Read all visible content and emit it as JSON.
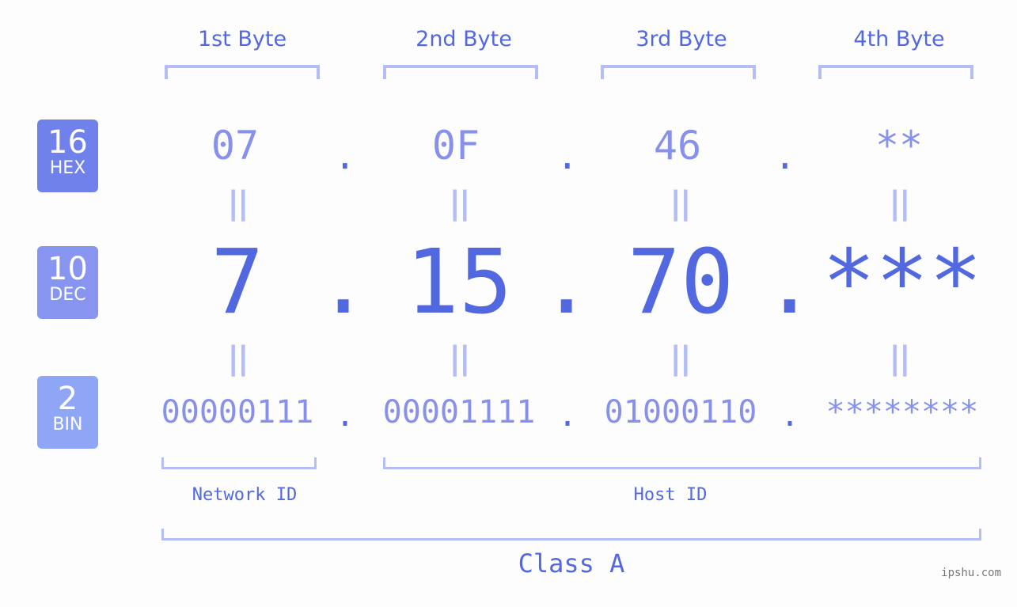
{
  "bytes": [
    {
      "label": "1st Byte",
      "hex": "07",
      "dec": "7",
      "bin": "00000111"
    },
    {
      "label": "2nd Byte",
      "hex": "0F",
      "dec": "15",
      "bin": "00001111"
    },
    {
      "label": "3rd Byte",
      "hex": "46",
      "dec": "70",
      "bin": "01000110"
    },
    {
      "label": "4th Byte",
      "hex": "**",
      "dec": "***",
      "bin": "********"
    }
  ],
  "badges": {
    "hex": {
      "num": "16",
      "label": "HEX",
      "color": "#7181ec"
    },
    "dec": {
      "num": "10",
      "label": "DEC",
      "color": "#8795f0"
    },
    "bin": {
      "num": "2",
      "label": "BIN",
      "color": "#8fa6f7"
    }
  },
  "separator": ".",
  "equals": "||",
  "network_label": "Network ID",
  "host_label": "Host ID",
  "class_label": "Class A",
  "watermark": "ipshu.com"
}
